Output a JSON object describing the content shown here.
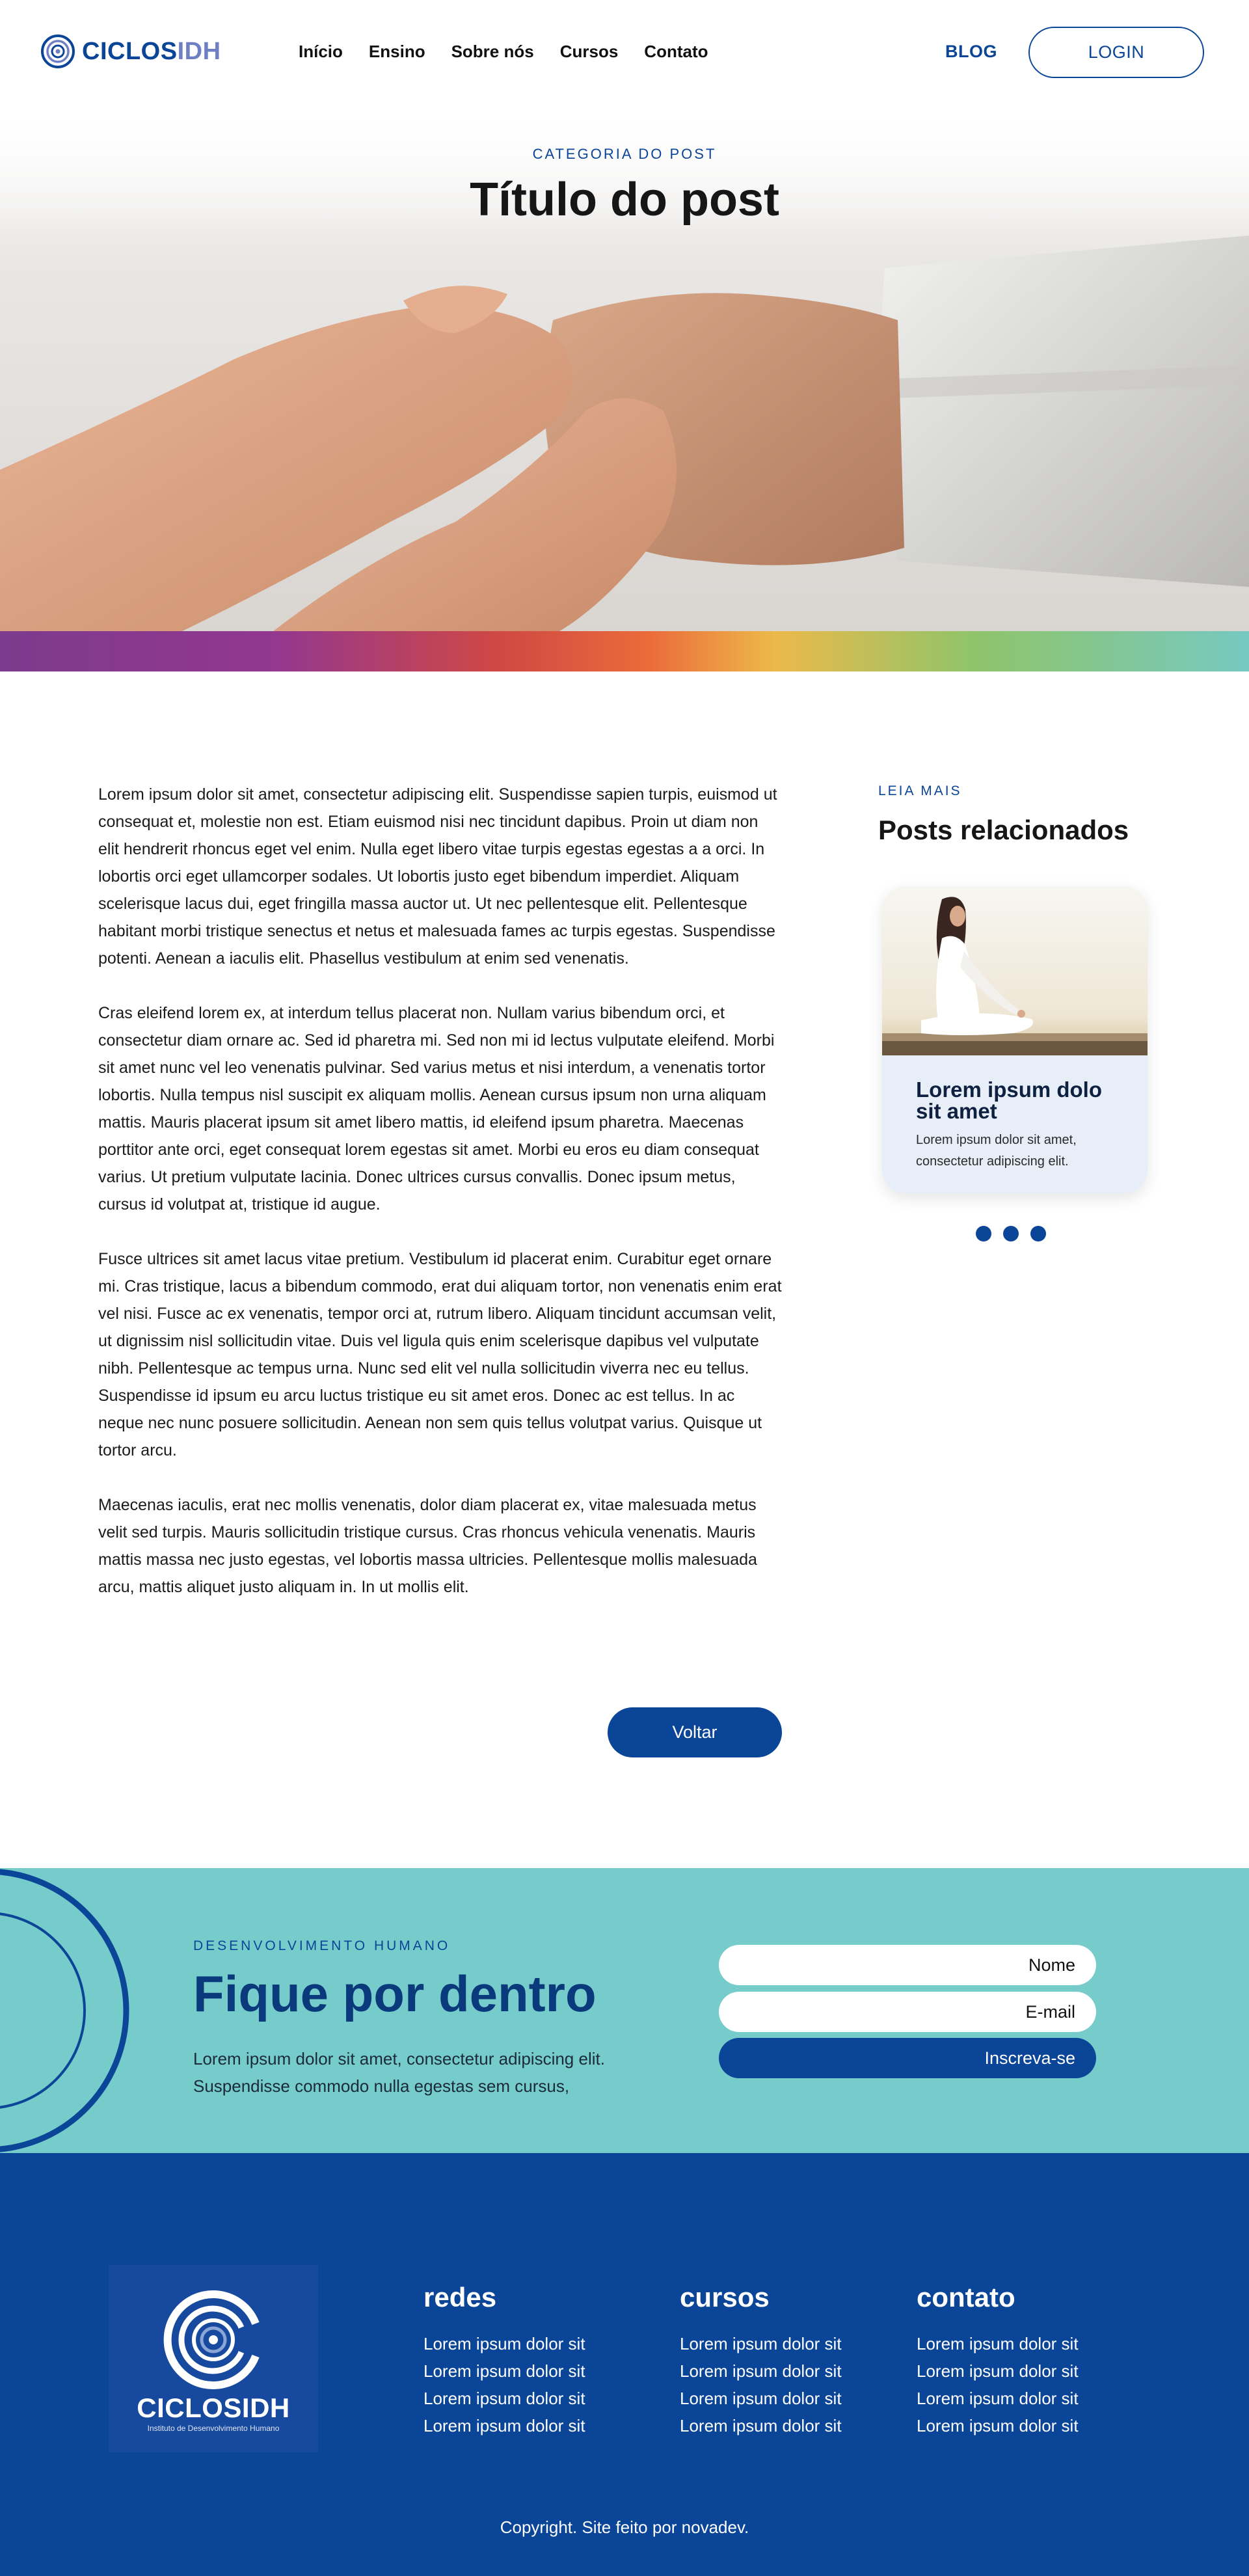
{
  "header": {
    "logo_part1": "CICLOS",
    "logo_part2": "IDH",
    "nav": [
      "Início",
      "Ensino",
      "Sobre nós",
      "Cursos",
      "Contato"
    ],
    "blog_label": "BLOG",
    "login_label": "LOGIN"
  },
  "hero": {
    "category": "CATEGORIA DO POST",
    "title": "Título do post"
  },
  "article": {
    "paragraphs": [
      "Lorem ipsum dolor sit amet, consectetur adipiscing elit. Suspendisse sapien turpis, euismod ut consequat et, molestie non est. Etiam euismod nisi nec tincidunt dapibus. Proin ut diam non elit hendrerit rhoncus eget vel enim. Nulla eget libero vitae turpis egestas egestas a a orci. In lobortis orci eget ullamcorper sodales. Ut lobortis justo eget bibendum imperdiet. Aliquam scelerisque lacus dui, eget fringilla massa auctor ut. Ut nec pellentesque elit. Pellentesque habitant morbi tristique senectus et netus et malesuada fames ac turpis egestas. Suspendisse potenti. Aenean a iaculis elit. Phasellus vestibulum at enim sed venenatis.",
      "Cras eleifend lorem ex, at interdum tellus placerat non. Nullam varius bibendum orci, et consectetur diam ornare ac. Sed id pharetra mi. Sed non mi id lectus vulputate eleifend. Morbi sit amet nunc vel leo venenatis pulvinar. Sed varius metus et nisi interdum, a venenatis tortor lobortis. Nulla tempus nisl suscipit ex aliquam mollis. Aenean cursus ipsum non urna aliquam mattis. Mauris placerat ipsum sit amet libero mattis, id eleifend ipsum pharetra. Maecenas porttitor ante orci, eget consequat lorem egestas sit amet. Morbi eu eros eu diam consequat varius. Ut pretium vulputate lacinia. Donec ultrices cursus convallis. Donec ipsum metus, cursus id volutpat at, tristique id augue.",
      "Fusce ultrices sit amet lacus vitae pretium. Vestibulum id placerat enim. Curabitur eget ornare mi. Cras tristique, lacus a bibendum commodo, erat dui aliquam tortor, non venenatis enim erat vel nisi. Fusce ac ex venenatis, tempor orci at, rutrum libero. Aliquam tincidunt accumsan velit, ut dignissim nisl sollicitudin vitae. Duis vel ligula quis enim scelerisque dapibus vel vulputate nibh. Pellentesque ac tempus urna. Nunc sed elit vel nulla sollicitudin viverra nec eu tellus. Suspendisse id ipsum eu arcu luctus tristique eu sit amet eros. Donec ac est tellus. In ac neque nec nunc posuere sollicitudin. Aenean non sem quis tellus volutpat varius. Quisque ut tortor arcu.",
      "Maecenas iaculis, erat nec mollis venenatis, dolor diam placerat ex, vitae malesuada metus velit sed turpis. Mauris sollicitudin tristique cursus. Cras rhoncus vehicula venenatis. Mauris mattis massa nec justo egestas, vel lobortis massa ultricies. Pellentesque mollis malesuada arcu, mattis aliquet justo aliquam in. In ut mollis elit."
    ],
    "back_label": "Voltar"
  },
  "sidebar": {
    "kicker": "LEIA MAIS",
    "title": "Posts relacionados",
    "card": {
      "title": "Lorem ipsum dolo sit amet",
      "text": "Lorem ipsum dolor sit amet, consectetur adipiscing elit."
    },
    "carousel_dots": 3
  },
  "newsletter": {
    "kicker": "DESENVOLVIMENTO HUMANO",
    "title": "Fique por dentro",
    "text": "Lorem ipsum dolor sit amet, consectetur adipiscing elit. Suspendisse commodo nulla egestas sem cursus,",
    "name_placeholder": "Nome",
    "email_placeholder": "E-mail",
    "submit_label": "Inscreva-se"
  },
  "footer": {
    "logo_name": "CICLOSIDH",
    "logo_sub": "Instituto de Desenvolvimento Humano",
    "columns": [
      {
        "title": "redes",
        "items": [
          "Lorem ipsum dolor sit",
          "Lorem ipsum dolor sit",
          "Lorem ipsum dolor sit",
          "Lorem ipsum dolor sit"
        ]
      },
      {
        "title": "cursos",
        "items": [
          "Lorem ipsum dolor sit",
          "Lorem ipsum dolor sit",
          "Lorem ipsum dolor sit",
          "Lorem ipsum dolor sit"
        ]
      },
      {
        "title": "contato",
        "items": [
          "Lorem ipsum dolor sit",
          "Lorem ipsum dolor sit",
          "Lorem ipsum dolor sit",
          "Lorem ipsum dolor sit"
        ]
      }
    ],
    "copyright": "Copyright. Site feito por novadev."
  },
  "colors": {
    "brand_blue": "#0a4597",
    "teal": "#76cccb",
    "light_blue": "#6f7fc3"
  }
}
